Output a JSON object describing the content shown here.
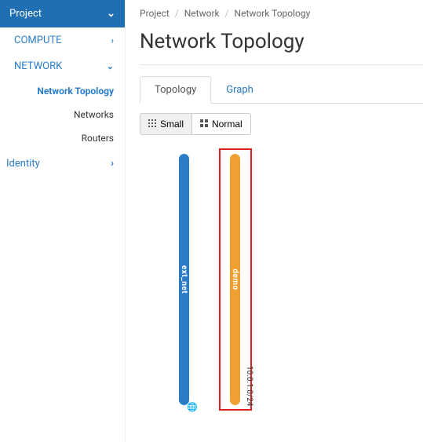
{
  "sidebar": {
    "project_label": "Project",
    "compute_label": "COMPUTE",
    "network_label": "NETWORK",
    "sub_items": [
      {
        "label": "Network Topology",
        "active": true
      },
      {
        "label": "Networks",
        "active": false
      },
      {
        "label": "Routers",
        "active": false
      }
    ],
    "identity_label": "Identity"
  },
  "breadcrumb": {
    "items": [
      "Project",
      "Network",
      "Network Topology"
    ]
  },
  "page_title": "Network Topology",
  "tabs": [
    {
      "label": "Topology",
      "active": true
    },
    {
      "label": "Graph",
      "active": false
    }
  ],
  "view_buttons": {
    "small": "Small",
    "normal": "Normal"
  },
  "networks": {
    "ext_net": {
      "label": "ext_net",
      "color": "#2a7cc7"
    },
    "demo": {
      "label": "demo",
      "color": "#f0a030",
      "cidr": "10.0.1.0/24",
      "highlighted": true
    }
  }
}
